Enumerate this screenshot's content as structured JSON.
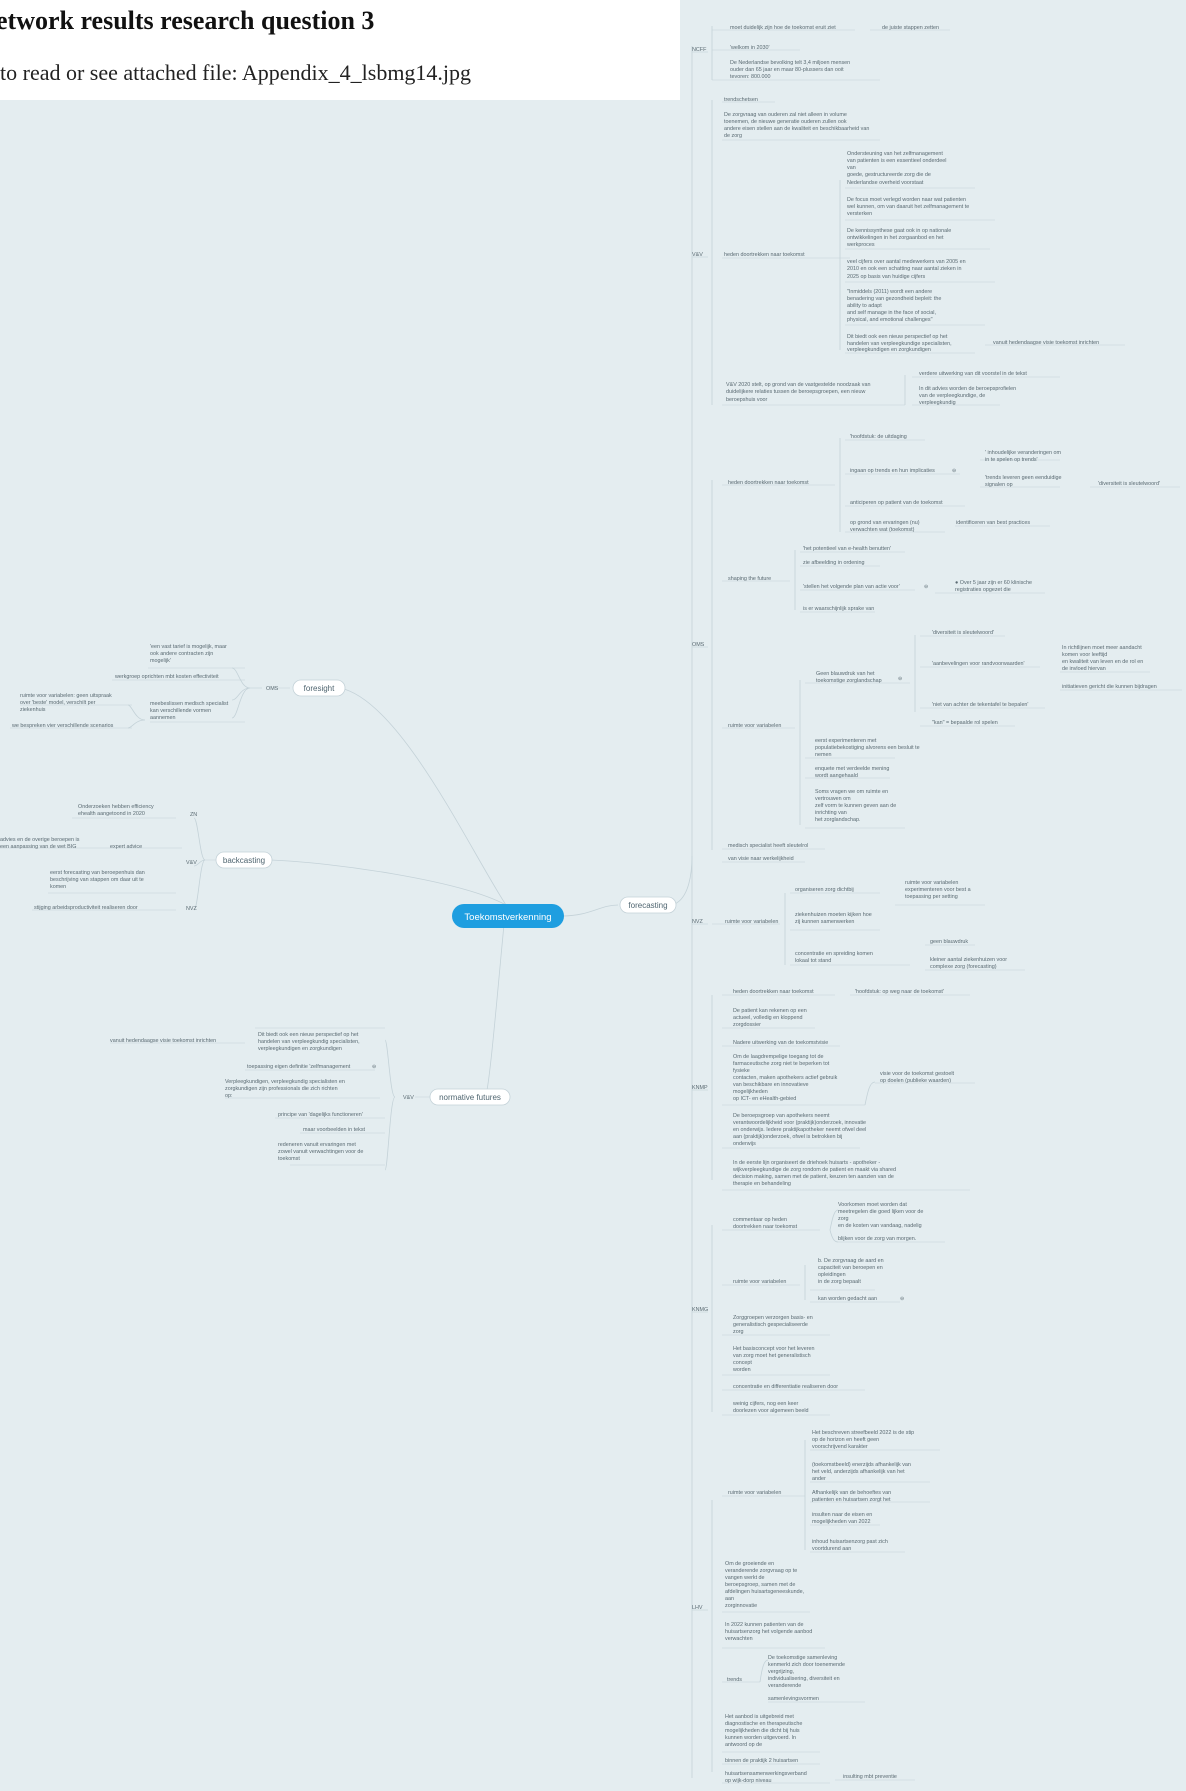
{
  "header": {
    "title": "etwork results research question 3",
    "subtitle": "to read or see attached file: Appendix_4_lsbmg14.jpg"
  },
  "colors": {
    "canvas": "#e4edf0",
    "central": "#1e9ee0",
    "line": "#c4d2d8",
    "text": "#5a6a72"
  },
  "mindmap": {
    "root": "Toekomstverkenning",
    "forecasting": {
      "label": "forecasting",
      "ncff": {
        "label": "NCFF",
        "c1": "moet duidelijk zijn hoe de toekomst eruit ziet",
        "c1a": "de juiste stappen zetten",
        "c2": "'welkom in 2030'",
        "c3a": "De Nederlandse bevolking telt 3,4 miljoen mensen",
        "c3b": "ouder dan 65 jaar en maar 80-plussers dan ooit",
        "c3c": "tevoren: 800.000"
      },
      "vv": {
        "label": "V&V",
        "trend": "trendschetsen",
        "z1": "De zorgvraag van ouderen zal niet alleen in volume",
        "z2": "toenemen, de nieuwe generatie ouderen zullen ook",
        "z3": "andere eisen stellen aan de kwaliteit en beschikbaarheid van",
        "z4": "de zorg",
        "heden": "heden doortrekken naar toekomst",
        "h1a": "Ondersteuning van het zelfmanagement",
        "h1b": "van patienten is een essentieel onderdeel",
        "h1c": "van",
        "h1d": "goede, gestructureerde zorg die de",
        "h1e": "Nederlandse overheid voorstaat",
        "h2a": "De focus moet verlegd worden naar wat patienten",
        "h2b": "wel kunnen, om van daaruit het zelfmanagement te",
        "h2c": "versterken",
        "h3a": "De kennissynthese gaat ook in op nationale",
        "h3b": "ontwikkelingen in het zorgaanbod en het",
        "h3c": "werkproces",
        "h4a": "veel cijfers over aantal medewerkers van 2005 en",
        "h4b": "2010 en ook een schatting naar aantal zieken in",
        "h4c": "2025 op basis van huidige cijfers",
        "h5a": "\"Inmiddels (2011) wordt een andere",
        "h5b": "benadering van gezondheid bepleit: the",
        "h5c": "ability to adapt",
        "h5d": "and self manage in the face of social,",
        "h5e": "physical, and emotional challenges\"",
        "h6a": "Dit biedt ook een nieuw perspectief op het",
        "h6b": "handelen van verpleegkundige specialisten,",
        "h6c": "verpleegkundigen en zorgkundigen",
        "h6x": "vanuit hedendaagse visie toekomst inrichten",
        "v1a": "V&V 2020 stelt, op grond van de vastgestelde noodzaak van",
        "v1b": "duidelijkere relaties tussen de beroepsgroepen, een nieuw",
        "v1c": "beroepshuis voor",
        "v1x": "verdere uitwerking van dit voorstel in de tekst",
        "v1y1": "In dit advies worden de beroepsprofielen",
        "v1y2": "van de verpleegkundige, de",
        "v1y3": "verpleegkundig"
      },
      "oms": {
        "label": "OMS",
        "heden": "heden doortrekken naar toekomst",
        "o1": "'hoofdstuk: de uitdaging",
        "o2": "ingaan op trends en hun implicaties",
        "o2a1": "' inhoudelijke veranderingen om",
        "o2a2": "in te spelen op trends'",
        "o2b1": "'trends leveren geen eenduidige",
        "o2b2": "signalen op",
        "o2c": "'diversiteit is sleutelwoord'",
        "o3": "anticiperen op patient van de toekomst",
        "o4a": "op grond van ervaringen (nu)",
        "o4b": "verwachten wat (toekomst)",
        "o4c": "identificeren van best practices",
        "shaping": "shaping the future",
        "s1": "'het potentieel van e-health benutten'",
        "s2": "zie afbeelding in ordening",
        "s3": "'stellen het volgende plan van actie voor'",
        "s3a1": "● Over 5 jaar zijn er 60 klinische",
        "s3a2": "registraties opgezet die",
        "s4": "is er waarschijnlijk sprake van",
        "ruimte": "ruimte voor variabelen",
        "r1a": "Geen blauwdruk van het",
        "r1b": "toekomstige zorglandschap",
        "r1c": "'diversiteit is sleutelwoord'",
        "r1d": "'aanbevelingen voor randvoorwaarden'",
        "r1d1": "In richtlijnen moet meer aandacht",
        "r1d2": "komen voor leeftijd",
        "r1d3": "en kwaliteit van leven en de rol en",
        "r1d4": "de invloed hiervan",
        "r1d5": "initiatieven gericht die kunnen bijdragen",
        "r1e": "'niet van achter de tekentafel te bepalen'",
        "r1f": "\"kan\" = bepaalde rol spelen",
        "r2a": "eerst experimenteren met",
        "r2b": "populatiebekostiging alvorens een besluit te",
        "r2c": "nemen",
        "r3a": "enquete met verdeelde mening",
        "r3b": "wordt aangehaald",
        "r4a": "Soms vragen we om ruimte en",
        "r4b": "vertrouwen om",
        "r4c": "zelf vorm te kunnen geven aan de",
        "r4d": "inrichting van",
        "r4e": "het zorglandschap.",
        "m1": "medisch specialist heeft sleutelrol",
        "m2": "van visie naar werkelijkheid"
      },
      "nvz": {
        "label": "NVZ",
        "ruimte": "ruimte voor variabelen",
        "n1": "organiseren zorg dichtbij",
        "n1a": "ruimte voor variabelen",
        "n1b": "experimenteren voor best a",
        "n1c": "toepassing per setting",
        "n2a": "ziekenhuizen moeten kijken hoe",
        "n2b": "zij kunnen samenwerken",
        "n3a": "concentratie en spreiding komen",
        "n3b": "lokaal tot stand",
        "n3c": "geen blauwdruk",
        "n3d": "kleiner aantal ziekenhuizen voor",
        "n3e": "complexe zorg (forecasting)"
      },
      "knmp": {
        "label": "KNMP",
        "heden": "heden doortrekken naar toekomst",
        "hx": "'hoofdstuk: op weg naar de toekomst'",
        "k1a": "De patient kan rekenen op een",
        "k1b": "actueel, volledig en kloppend",
        "k1c": "zorgdossier",
        "k2": "Nadere uitwerking van de toekomstvisie",
        "k3a": "Om de laagdrempelige toegang tot de",
        "k3b": "farmaceutische zorg niet te beperken tot",
        "k3c": "fysieke",
        "k3d": "contacten, maken apothekers actief gebruik",
        "k3e": "van beschikbare en innovatieve",
        "k3f": "mogelijkheden",
        "k3g": "op ICT- en eHealth-gebied",
        "k3x1": "visie voor de toekomst gestoelt",
        "k3x2": "op doelen (publieke waarden)",
        "k4a": "De beroepsgroep van apothekers neemt",
        "k4b": "verantwoordelijkheid voor (praktijk)onderzoek, innovatie",
        "k4c": "en onderwijs. Iedere praktijkapotheker neemt ofwel deel",
        "k4d": "aan (praktijk)onderzoek, ofwel is betrokken bij",
        "k4e": "onderwijs",
        "k5a": "In de eerste lijn organiseert de driehoek huisarts - apotheker -",
        "k5b": "wijkverpleegkundige de zorg rondom de patient en maakt via shared",
        "k5c": "decision making, samen met de patient, keuzen ten aanzien van de",
        "k5d": "therapie en behandeling"
      },
      "knmg": {
        "label": "KNMG",
        "c1a": "commentaar op heden",
        "c1b": "doortrekken naar toekomst",
        "c1x1": "Voorkomen moet worden dat",
        "c1x2": "meetregelen die goed lijken voor de",
        "c1x3": "zorg",
        "c1x4": "en de kosten van vandaag, nadelig",
        "c1x5": "blijken voor de zorg van morgen.",
        "ruimte": "ruimte voor variabelen",
        "r1a": "b. De zorgvraag de aard en",
        "r1b": "capaciteit van beroepen en",
        "r1c": "opleidingen",
        "r1d": "in de zorg bepaalt",
        "r2": "kan worden gedacht aan",
        "g1a": "Zorggroepen verzorgen basis- en",
        "g1b": "generalistisch gespecialiseerde",
        "g1c": "zorg",
        "g2a": "Het basisconcept voor het leveren",
        "g2b": "van zorg moet het generalistisch",
        "g2c": "concept",
        "g2d": "worden",
        "g3": "concentratie en differentiatie realiseren door",
        "g4a": "weinig cijfers, nog een keer",
        "g4b": "doorlezen voor algemeen beeld"
      },
      "lhv": {
        "label": "LHV",
        "ruimte": "ruimte voor variabelen",
        "l1a": "Het beschreven streefbeeld 2022 is de stip",
        "l1b": "op de horizon en heeft geen",
        "l1c": "voorschrijvend karakter",
        "l2a": "(toekomstbeeld) enerzijds afhankelijk van",
        "l2b": "het veld, anderzijds afhankelijk van het",
        "l2c": "ander",
        "l3a": "Afhankelijk van de behoeftes van",
        "l3b": "patienten en huisartsen zorgt het",
        "l4a": "insulten naar de eisen en",
        "l4b": "mogelijkheden van 2022",
        "l5a": "inhoud huisartsenzorg past zich",
        "l5b": "voortdurend aan",
        "g1a": "Om de groeiende en",
        "g1b": "veranderende zorgvraag op te",
        "g1c": "vangen werkt de",
        "g1d": "beroepsgroep, samen met de",
        "g1e": "afdelingen huisartsgeneeskunde,",
        "g1f": "aan",
        "g1g": "zorginnovatie",
        "g2a": "In 2022 kunnen patienten van de",
        "g2b": "huisartsenzorg het volgende aanbod",
        "g2c": "verwachten",
        "trends": "trends",
        "t1a": "De toekomstige samenleving",
        "t1b": "kenmerkt zich door toenemende",
        "t1c": "vergrijzing,",
        "t1d": "individualisering, diversiteit en",
        "t1e": "veranderende",
        "t1f": "samenlevingsvormen",
        "g3a": "Het aanbod is uitgebreid met",
        "g3b": "diagnostische en therapeutische",
        "g3c": "mogelijkheden die dicht bij huis",
        "g3d": "kunnen worden uitgevoerd. In",
        "g3e": "antwoord op de",
        "g4": "binnen de praktijk 2 huisartsen",
        "g5a": "huisartsensamenwerkingsverband",
        "g5b": "op wijk-dorp niveau",
        "g5x": "insulting mbt preventie"
      }
    },
    "foresight": {
      "label": "foresight",
      "oms": "OMS",
      "f1a": "'een vast tarief is mogelijk, maar",
      "f1b": "ook andere contracten zijn",
      "f1c": "mogelijk'",
      "f2": "werkgroep oprichten mbt kosten effectiviteit",
      "f3a": "ruimte voor variabelen: geen uitspraak",
      "f3b": "over 'beste' model, verschilt per",
      "f3c": "ziekenhuis",
      "f4a": "meebeslissen medisch specialist",
      "f4b": "kan verschillende vormen",
      "f4c": "aannemen",
      "f5": "we bespreken vier verschillende scenarios"
    },
    "backcasting": {
      "label": "backcasting",
      "zn": "ZN",
      "zn1a": "Onderzoeken hebben efficiency",
      "zn1b": "ehealth aangetoond in 2020",
      "vv": "V&V",
      "vv1a": "advies en de overige beroepen is",
      "vv1b": "een aanpassing van de wet BIG",
      "vv1x": "expert advice",
      "vv2a": "eerst forecasting van beroepenhuis dan",
      "vv2b": "beschrijving van stappen om daar uit te",
      "vv2c": "komen",
      "nvz": "NVZ",
      "nvz1": "stijging arbeidsproductiviteit realiseren door"
    },
    "normative": {
      "label": "normative futures",
      "vv": "V&V",
      "n1a": "Dit biedt ook een nieuw perspectief op het",
      "n1b": "handelen van verpleegkundig specialisten,",
      "n1c": "verpleegkundigen en zorgkundigen",
      "n1x": "vanuit hedendaagse visie toekomst inrichten",
      "n2": "toepassing eigen definitie 'zelfmanagement",
      "n3a": "Verpleegkundigen, verpleegkundig specialisten en",
      "n3b": "zorgkundigen zijn professionals die zich richten",
      "n3c": "op:",
      "n4": "principe van 'dagelijks functioneren'",
      "n5": "maar voorbeelden in tekst",
      "n6a": "redeneren vanuit ervaringen met",
      "n6b": "zowel vanuit verwachtingen voor de",
      "n6c": "toekomst"
    }
  }
}
